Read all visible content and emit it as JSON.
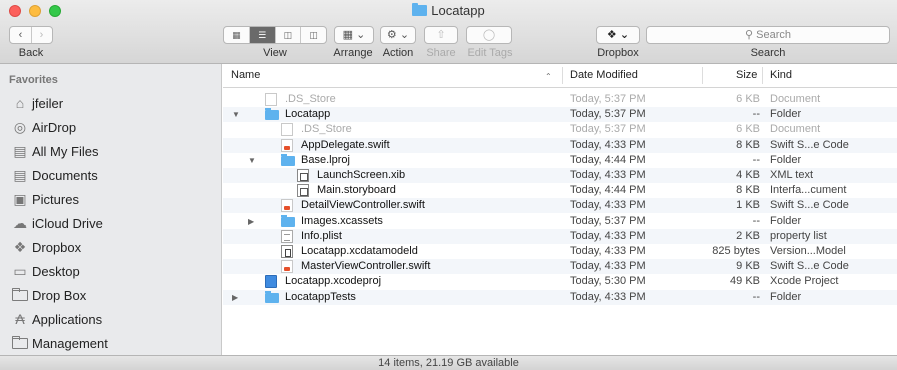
{
  "window": {
    "title": "Locatapp"
  },
  "toolbar": {
    "back_label": "Back",
    "view_label": "View",
    "arrange_label": "Arrange",
    "action_label": "Action",
    "share_label": "Share",
    "edit_tags_label": "Edit Tags",
    "dropbox_label": "Dropbox",
    "search_label": "Search",
    "search_placeholder": "Search"
  },
  "sidebar": {
    "header": "Favorites",
    "items": [
      {
        "label": "jfeiler",
        "icon": "home-icon"
      },
      {
        "label": "AirDrop",
        "icon": "airdrop-icon"
      },
      {
        "label": "All My Files",
        "icon": "all-files-icon"
      },
      {
        "label": "Documents",
        "icon": "documents-icon"
      },
      {
        "label": "Pictures",
        "icon": "pictures-icon"
      },
      {
        "label": "iCloud Drive",
        "icon": "cloud-icon"
      },
      {
        "label": "Dropbox",
        "icon": "dropbox-icon"
      },
      {
        "label": "Desktop",
        "icon": "desktop-icon"
      },
      {
        "label": "Drop Box",
        "icon": "folder-icon"
      },
      {
        "label": "Applications",
        "icon": "applications-icon"
      },
      {
        "label": "Management",
        "icon": "folder-icon"
      }
    ]
  },
  "columns": {
    "name": "Name",
    "date": "Date Modified",
    "size": "Size",
    "kind": "Kind"
  },
  "files": [
    {
      "name": ".DS_Store",
      "date": "Today, 5:37 PM",
      "size": "6 KB",
      "kind": "Document",
      "depth": 0,
      "icon": "doc",
      "tri": "",
      "faded": true
    },
    {
      "name": "Locatapp",
      "date": "Today, 5:37 PM",
      "size": "--",
      "kind": "Folder",
      "depth": 0,
      "icon": "folder",
      "tri": "▼",
      "faded": false
    },
    {
      "name": ".DS_Store",
      "date": "Today, 5:37 PM",
      "size": "6 KB",
      "kind": "Document",
      "depth": 1,
      "icon": "doc",
      "tri": "",
      "faded": true
    },
    {
      "name": "AppDelegate.swift",
      "date": "Today, 4:33 PM",
      "size": "8 KB",
      "kind": "Swift S...e Code",
      "depth": 1,
      "icon": "swift",
      "tri": "",
      "faded": false
    },
    {
      "name": "Base.lproj",
      "date": "Today, 4:44 PM",
      "size": "--",
      "kind": "Folder",
      "depth": 1,
      "icon": "folder",
      "tri": "▼",
      "faded": false
    },
    {
      "name": "LaunchScreen.xib",
      "date": "Today, 4:33 PM",
      "size": "4 KB",
      "kind": "XML text",
      "depth": 2,
      "icon": "xib",
      "tri": "",
      "faded": false
    },
    {
      "name": "Main.storyboard",
      "date": "Today, 4:44 PM",
      "size": "8 KB",
      "kind": "Interfa...cument",
      "depth": 2,
      "icon": "xib",
      "tri": "",
      "faded": false
    },
    {
      "name": "DetailViewController.swift",
      "date": "Today, 4:33 PM",
      "size": "1 KB",
      "kind": "Swift S...e Code",
      "depth": 1,
      "icon": "swift",
      "tri": "",
      "faded": false
    },
    {
      "name": "Images.xcassets",
      "date": "Today, 5:37 PM",
      "size": "--",
      "kind": "Folder",
      "depth": 1,
      "icon": "folder",
      "tri": "▶",
      "faded": false
    },
    {
      "name": "Info.plist",
      "date": "Today, 4:33 PM",
      "size": "2 KB",
      "kind": "property list",
      "depth": 1,
      "icon": "plist",
      "tri": "",
      "faded": false
    },
    {
      "name": "Locatapp.xcdatamodeld",
      "date": "Today, 4:33 PM",
      "size": "825 bytes",
      "kind": "Version...Model",
      "depth": 1,
      "icon": "model",
      "tri": "",
      "faded": false
    },
    {
      "name": "MasterViewController.swift",
      "date": "Today, 4:33 PM",
      "size": "9 KB",
      "kind": "Swift S...e Code",
      "depth": 1,
      "icon": "swift",
      "tri": "",
      "faded": false
    },
    {
      "name": "Locatapp.xcodeproj",
      "date": "Today, 5:30 PM",
      "size": "49 KB",
      "kind": "Xcode Project",
      "depth": 0,
      "icon": "proj",
      "tri": "",
      "faded": false
    },
    {
      "name": "LocatappTests",
      "date": "Today, 4:33 PM",
      "size": "--",
      "kind": "Folder",
      "depth": 0,
      "icon": "folder",
      "tri": "▶",
      "faded": false
    }
  ],
  "status": {
    "text": "14 items, 21.19 GB available"
  }
}
